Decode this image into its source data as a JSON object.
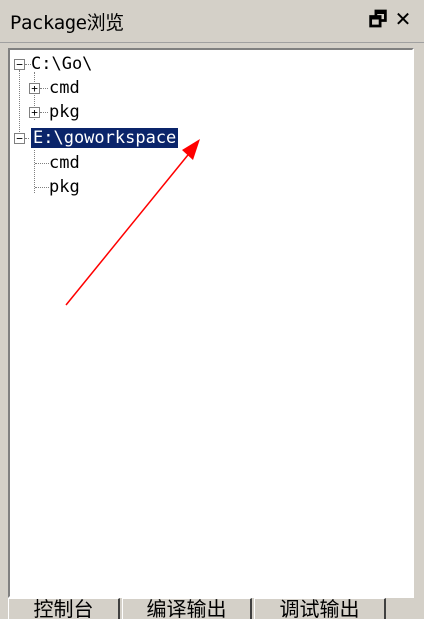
{
  "panel": {
    "title": "Package浏览",
    "float_icon": "float-window-icon",
    "close_icon": "close-icon"
  },
  "tree": {
    "roots": [
      {
        "label": "C:\\Go\\",
        "expanded": true,
        "children": [
          {
            "label": "cmd",
            "expander": "+"
          },
          {
            "label": "pkg",
            "expander": "+"
          }
        ]
      },
      {
        "label": "E:\\goworkspace",
        "expanded": true,
        "selected": true,
        "children": [
          {
            "label": "cmd"
          },
          {
            "label": "pkg"
          }
        ]
      }
    ]
  },
  "tabs": [
    {
      "label": "控制台"
    },
    {
      "label": "编译输出"
    },
    {
      "label": "调试输出"
    }
  ],
  "annotation": {
    "type": "red-arrow",
    "color": "#ff0000"
  },
  "colors": {
    "selection": "#0a246a",
    "face": "#d4d0c8"
  }
}
